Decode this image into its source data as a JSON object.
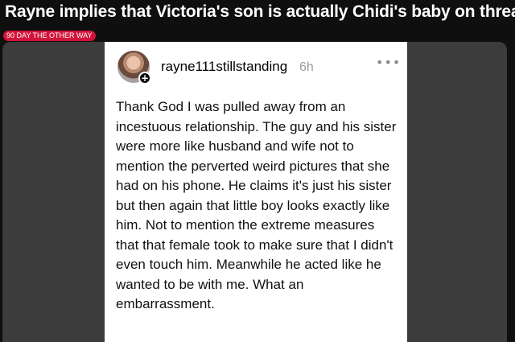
{
  "headline": "Rayne implies that Victoria's son is actually Chidi's baby on threads",
  "flair": "90 DAY THE OTHER WAY",
  "post": {
    "username": "rayne111stillstanding",
    "time": "6h",
    "more_icon": "more-horizontal-icon",
    "plus_icon": "plus-icon",
    "body": "Thank God I was pulled away from an incestuous relationship. The guy and his sister were more like husband and wife not to mention the perverted weird pictures that she had on his phone. He claims it's just his sister but then again that little boy looks exactly like him. Not to mention the extreme measures that that female took to make sure that I didn't even touch him. Meanwhile he acted like he wanted to be with me. What an embarrassment."
  },
  "colors": {
    "background": "#0f0f0f",
    "flair": "#d2143a",
    "media_backdrop": "#3c3c3c",
    "card": "#ffffff",
    "time": "#9a9a9a"
  }
}
